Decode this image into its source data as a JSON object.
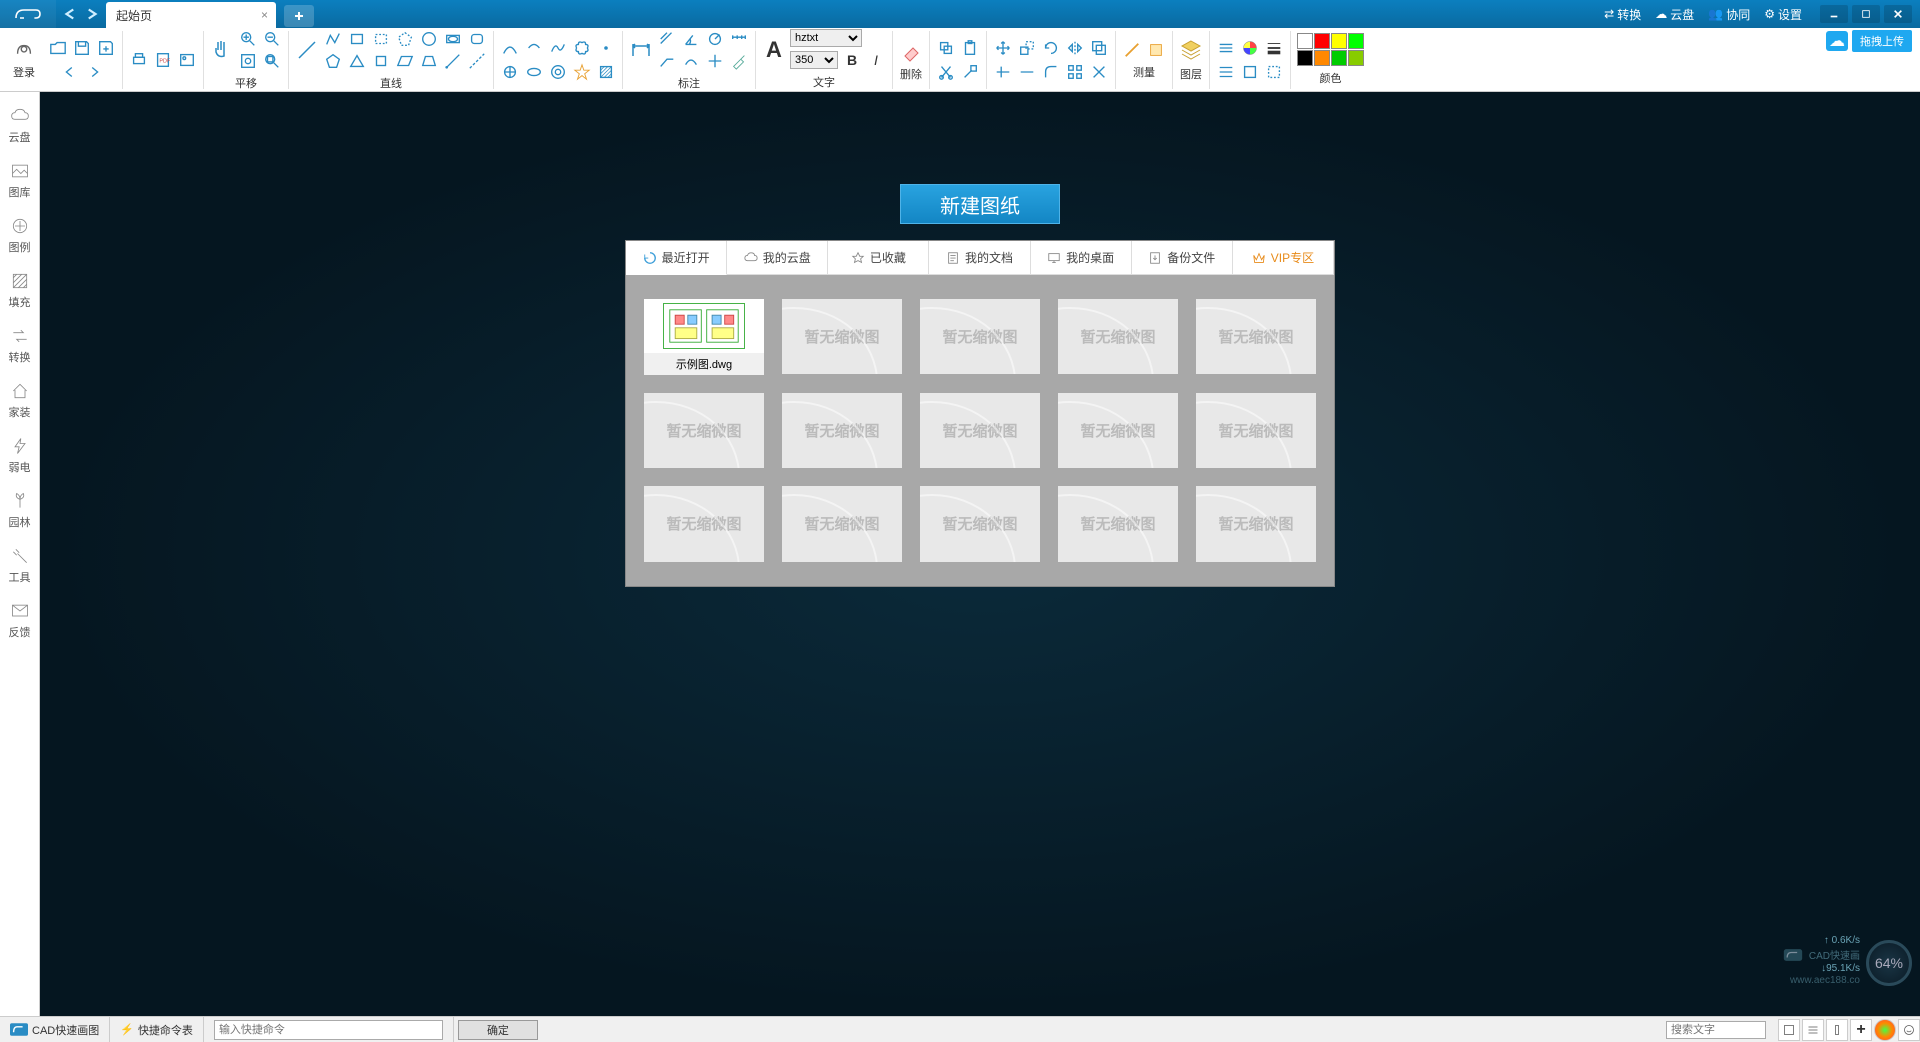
{
  "titlebar": {
    "tab_label": "起始页",
    "menu": {
      "convert": "转换",
      "cloud": "云盘",
      "collab": "协同",
      "settings": "设置"
    }
  },
  "upload_badge": "拖拽上传",
  "toolbar": {
    "login": "登录",
    "groups": {
      "pan": "平移",
      "line": "直线",
      "annotate": "标注",
      "text": "文字",
      "font_name": "hztxt",
      "font_size": "350",
      "delete": "删除",
      "measure": "测量",
      "layer": "图层",
      "color": "颜色"
    }
  },
  "sidebar": {
    "items": [
      {
        "label": "云盘"
      },
      {
        "label": "图库"
      },
      {
        "label": "图例"
      },
      {
        "label": "填充"
      },
      {
        "label": "转换"
      },
      {
        "label": "家装"
      },
      {
        "label": "弱电"
      },
      {
        "label": "园林"
      },
      {
        "label": "工具"
      },
      {
        "label": "反馈"
      }
    ]
  },
  "canvas": {
    "new_drawing": "新建图纸",
    "tabs": [
      "最近打开",
      "我的云盘",
      "已收藏",
      "我的文档",
      "我的桌面",
      "备份文件",
      "VIP专区"
    ],
    "placeholder": "暂无缩微图",
    "sample_file": "示例图.dwg"
  },
  "statusbar": {
    "app_name": "CAD快速画图",
    "shortcut_table": "快捷命令表",
    "cmd_placeholder": "输入快捷命令",
    "ok": "确定",
    "search_placeholder": "搜索文字"
  },
  "overlay": {
    "up_speed": "↑ 0.6K/s",
    "down_speed": "↓95.1K/s",
    "brand": "CAD快速画",
    "brand_url": "www.aec188.co",
    "percent": "64%"
  },
  "colors": [
    "#ff0000",
    "#ffff00",
    "#00ff00",
    "#00ffff",
    "#ffffff",
    "#000000",
    "#ff8800",
    "#88ff00"
  ]
}
